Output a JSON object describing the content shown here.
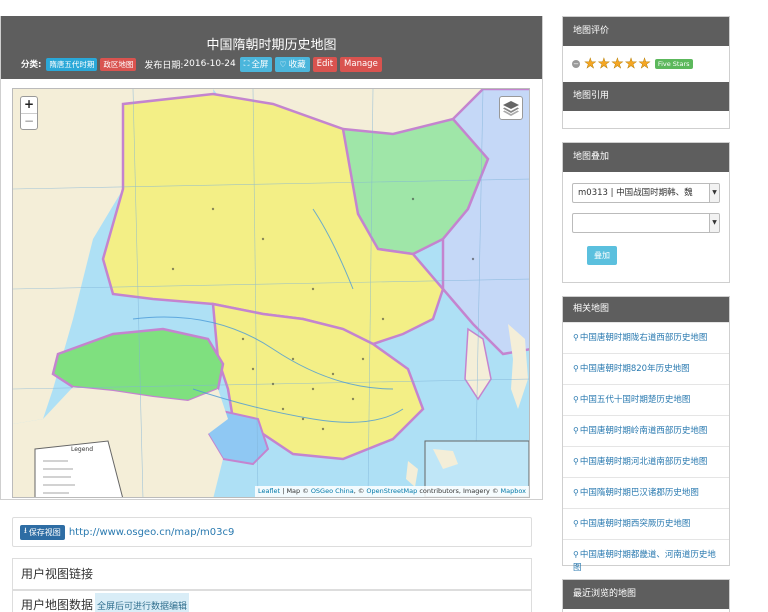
{
  "map": {
    "title": "中国隋朝时期历史地图",
    "category_label": "分类:",
    "tags": [
      "隋唐五代时期",
      "政区地图"
    ],
    "date_label": "发布日期:",
    "date": "2016-10-24",
    "actions": {
      "fullscreen": "全屏",
      "favorite": "收藏",
      "edit": "Edit",
      "manage": "Manage"
    },
    "zoom_in": "+",
    "zoom_out": "−",
    "legend": "Legend",
    "attribution": {
      "leaflet": "Leaflet",
      "map_by": "| Map ©",
      "osgeo": "OSGeo China",
      "sep1": ", ©",
      "osm": "OpenStreetMap",
      "contrib": "contributors, Imagery ©",
      "mapbox": "Mapbox"
    }
  },
  "save_view": {
    "button": "保存视图",
    "url": "http://www.osgeo.cn/map/m03c9"
  },
  "user_view_link_title": "用户视图链接",
  "user_map_data": {
    "title": "用户地图数据",
    "hint": "全屏后可进行数据编辑"
  },
  "sidebar": {
    "rating": {
      "title": "地图评价",
      "caption": "Five Stars",
      "stars": 5
    },
    "citation_title": "地图引用",
    "overlay": {
      "title": "地图叠加",
      "select1": "m0313 | 中国战国时期韩、魏",
      "select2": "",
      "button": "叠加"
    },
    "related": {
      "title": "相关地图",
      "items": [
        "中国唐朝时期陇右道西部历史地图",
        "中国唐朝时期820年历史地图",
        "中国五代十国时期楚历史地图",
        "中国唐朝时期岭南道西部历史地图",
        "中国唐朝时期河北道南部历史地图",
        "中国隋朝时期巴汉诸郡历史地图",
        "中国唐朝时期西突厥历史地图",
        "中国唐朝时期都畿道、河南道历史地图"
      ]
    },
    "recent_title": "最近浏览的地图"
  },
  "colors": {
    "header": "#5e5e5e",
    "sea": "#aee0f5",
    "sui_territory": "#f3ef86",
    "tuyuhun": "#7fe07f",
    "eastern_turks": "#9fe6a8",
    "goguryeo": "#c5d8f7",
    "border": "#c484cf"
  }
}
